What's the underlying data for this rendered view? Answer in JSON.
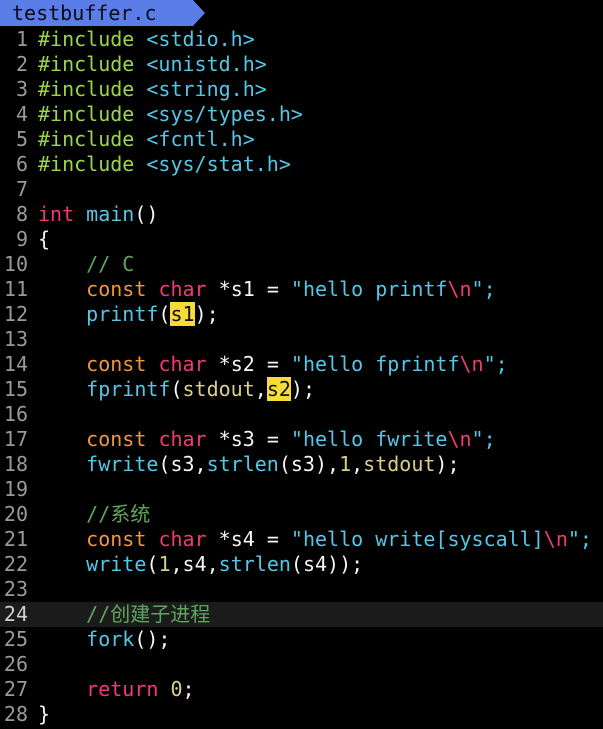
{
  "tab": {
    "filename": "testbuffer.c"
  },
  "lines": [
    {
      "n": "1",
      "inc_path": "<stdio.h>"
    },
    {
      "n": "2",
      "inc_path": "<unistd.h>"
    },
    {
      "n": "3",
      "inc_path": "<string.h>"
    },
    {
      "n": "4",
      "inc_path": "<sys/types.h>"
    },
    {
      "n": "5",
      "inc_path": "<fcntl.h>"
    },
    {
      "n": "6",
      "inc_path": "<sys/stat.h>"
    },
    {
      "n": "7"
    },
    {
      "n": "8",
      "ret_type": "int",
      "fn_name": "main",
      "parens": "()"
    },
    {
      "n": "9",
      "text": "{"
    },
    {
      "n": "10",
      "comment": "// C"
    },
    {
      "n": "11",
      "var": " *s1 = ",
      "str_open": "\"hello printf",
      "str_close": "\";"
    },
    {
      "n": "12",
      "call": "printf",
      "open": "(",
      "arg": "s1",
      "close": ");"
    },
    {
      "n": "13"
    },
    {
      "n": "14",
      "var": " *s2 = ",
      "str_open": "\"hello fprintf",
      "str_close": "\";"
    },
    {
      "n": "15",
      "call": "fprintf",
      "open": "(",
      "arg1": "stdout",
      "comma": ",",
      "arg": "s2",
      "close": ");"
    },
    {
      "n": "16"
    },
    {
      "n": "17",
      "var": " *s3 = ",
      "str_open": "\"hello fwrite",
      "str_close": "\";"
    },
    {
      "n": "18",
      "call": "fwrite",
      "p1": "(s3,",
      "call2": "strlen",
      "p2": "(s3),",
      "num": "1",
      "p3": ",",
      "arg4": "stdout",
      "close": ");"
    },
    {
      "n": "19"
    },
    {
      "n": "20",
      "comment": "//系统"
    },
    {
      "n": "21",
      "var": " *s4 = ",
      "str_open": "\"hello write[syscall]",
      "str_close": "\";"
    },
    {
      "n": "22",
      "call": "write",
      "open": "(",
      "num": "1",
      "p2": ",s4,",
      "call2": "strlen",
      "close": "(s4));"
    },
    {
      "n": "23"
    },
    {
      "n": "24",
      "comment": "//创建子进程"
    },
    {
      "n": "25",
      "call": "fork",
      "close": "();"
    },
    {
      "n": "26"
    },
    {
      "n": "27",
      "kw": "return",
      "space": " ",
      "num": "0",
      "close": ";"
    },
    {
      "n": "28",
      "text": "}"
    }
  ],
  "tokens": {
    "include": "#include",
    "const": "const",
    "char": "char",
    "escape": "\\n"
  },
  "colors": {
    "background": "#000000",
    "tab": "#5b7de8",
    "preprocessor": "#9ad64b",
    "keyword": "#ef3b74",
    "type": "#f2963d",
    "function": "#54c6e6",
    "string": "#54c6e6",
    "number": "#d8d08a",
    "comment": "#5ea55e",
    "search_highlight": "#f7db3a"
  }
}
